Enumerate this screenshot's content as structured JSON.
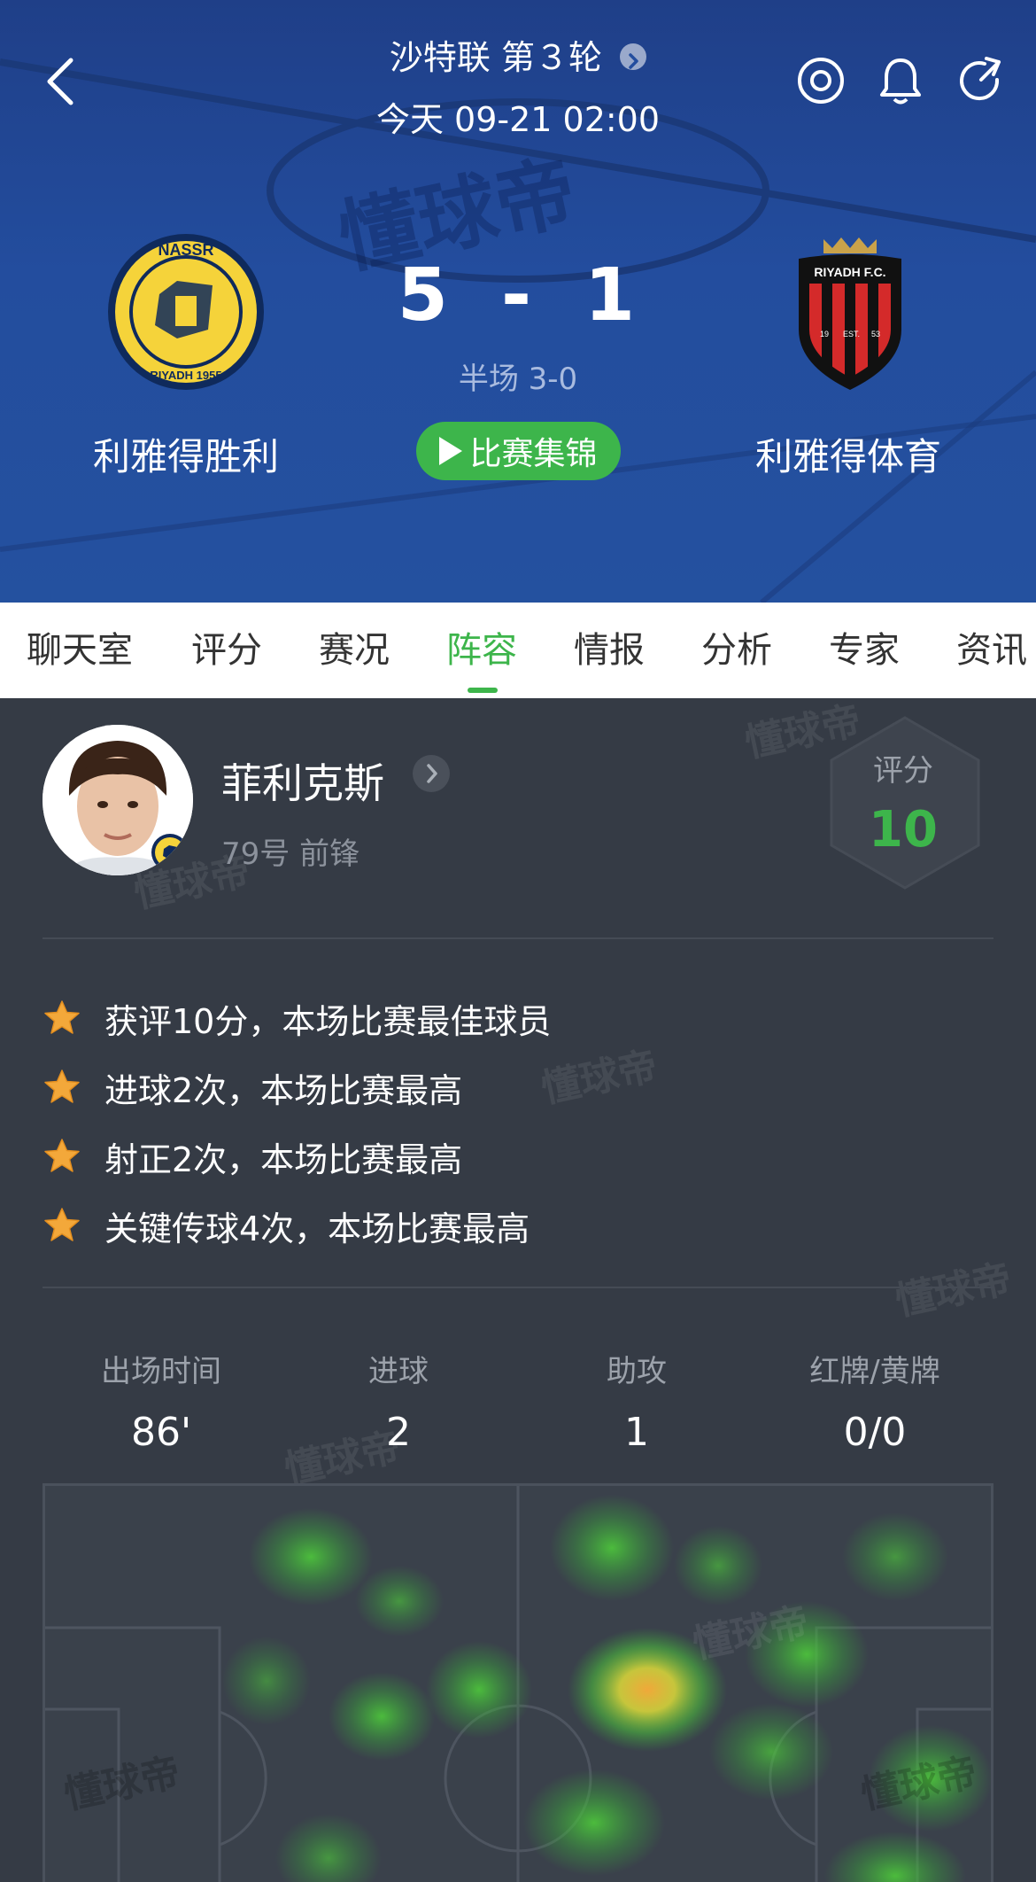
{
  "header": {
    "league": "沙特联 第３轮",
    "datetime": "今天 09-21 02:00",
    "home_team": "利雅得胜利",
    "away_team": "利雅得体育",
    "home_score": "5",
    "score_separator": "-",
    "away_score": "1",
    "halftime": "半场 3-0",
    "highlight_label": "比赛集锦",
    "home_logo_text_top": "NASSR",
    "home_logo_text_bottom": "RIYADH 1955",
    "away_logo_text": "RIYADH F.C.",
    "away_logo_est_left": "19",
    "away_logo_est": "EST.",
    "away_logo_est_right": "53"
  },
  "tabs": [
    {
      "label": "聊天室"
    },
    {
      "label": "评分"
    },
    {
      "label": "赛况"
    },
    {
      "label": "阵容"
    },
    {
      "label": "情报"
    },
    {
      "label": "分析"
    },
    {
      "label": "专家"
    },
    {
      "label": "资讯"
    }
  ],
  "active_tab_index": 3,
  "player": {
    "name": "菲利克斯",
    "info": "79号 前锋",
    "rating_label": "评分",
    "rating": "10"
  },
  "honors": [
    "获评10分，本场比赛最佳球员",
    "进球2次，本场比赛最高",
    "射正2次，本场比赛最高",
    "关键传球4次，本场比赛最高"
  ],
  "stats": [
    {
      "label": "出场时间",
      "value": "86'"
    },
    {
      "label": "进球",
      "value": "2"
    },
    {
      "label": "助攻",
      "value": "1"
    },
    {
      "label": "红牌/黄牌",
      "value": "0/0"
    }
  ],
  "watermark": "懂球帝",
  "colors": {
    "accent": "#3db54b",
    "header_bg": "#234d9e",
    "page_bg": "#353b45",
    "home_logo": "#f5d33a",
    "away_logo_red": "#d42a2a"
  }
}
